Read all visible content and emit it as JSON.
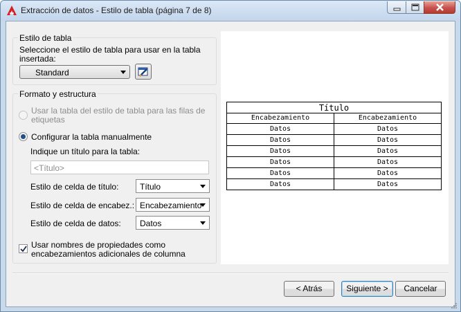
{
  "window": {
    "title": "Extracción de datos - Estilo de tabla (página 7 de 8)",
    "app_icon": "autocad-icon",
    "controls": [
      "minimize-icon",
      "maximize-icon",
      "close-icon"
    ]
  },
  "table_style": {
    "group_label": "Estilo de tabla",
    "prompt_line1": "Seleccione el estilo de tabla para usar en la tabla",
    "prompt_line2": "insertada:",
    "selected": "Standard",
    "edit_icon": "table-style-edit-icon"
  },
  "format": {
    "group_label": "Formato y estructura",
    "radio_use_style_line1": "Usar la tabla del estilo de tabla para las filas de",
    "radio_use_style_line2": "etiquetas",
    "radio_manual": "Configurar la tabla manualmente",
    "title_prompt": "Indique un título para la tabla:",
    "title_placeholder": "<Título>",
    "title_cell_label": "Estilo de celda de título:",
    "title_cell_value": "Título",
    "header_cell_label": "Estilo de celda de encabez.:",
    "header_cell_value": "Encabezamiento",
    "data_cell_label": "Estilo de celda de datos:",
    "data_cell_value": "Datos",
    "checkbox_line1": "Usar nombres de propiedades como",
    "checkbox_line2": "encabezamientos adicionales de columna",
    "checkbox_checked": true
  },
  "preview": {
    "title": "Título",
    "headers": [
      "Encabezamiento",
      "Encabezamiento"
    ],
    "rows": [
      [
        "Datos",
        "Datos"
      ],
      [
        "Datos",
        "Datos"
      ],
      [
        "Datos",
        "Datos"
      ],
      [
        "Datos",
        "Datos"
      ],
      [
        "Datos",
        "Datos"
      ],
      [
        "Datos",
        "Datos"
      ]
    ]
  },
  "buttons": {
    "back": "< Atrás",
    "next": "Siguiente >",
    "cancel": "Cancelar"
  },
  "colors": {
    "accent": "#224e8a",
    "titlebar": "#c3d6ec",
    "close": "#c75050"
  }
}
